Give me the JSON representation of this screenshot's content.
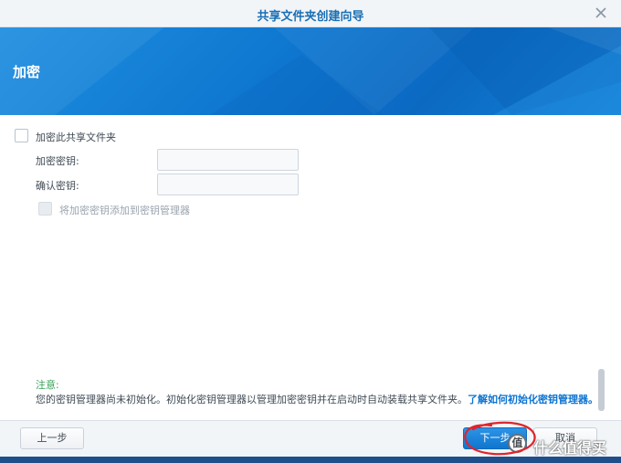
{
  "window": {
    "title": "共享文件夹创建向导",
    "close_icon": "close-icon"
  },
  "banner": {
    "heading": "加密"
  },
  "form": {
    "encrypt_checkbox_label": "加密此共享文件夹",
    "encrypt_checked": false,
    "key_label": "加密密钥:",
    "key_value": "",
    "confirm_label": "确认密钥:",
    "confirm_value": "",
    "add_to_manager_label": "将加密密钥添加到密钥管理器",
    "add_to_manager_enabled": false
  },
  "note": {
    "title": "注意:",
    "text": "您的密钥管理器尚未初始化。初始化密钥管理器以管理加密密钥并在启动时自动装载共享文件夹。",
    "link": "了解如何初始化密钥管理器。"
  },
  "footer": {
    "back_label": "上一步",
    "next_label": "下一步",
    "cancel_label": "取消"
  },
  "watermark": {
    "badge": "值",
    "text": "什么值得买"
  },
  "colors": {
    "accent": "#0f76cf",
    "title_blue": "#1a6fb4",
    "note_green": "#3aa35a",
    "annotation_red": "#e0242b"
  }
}
